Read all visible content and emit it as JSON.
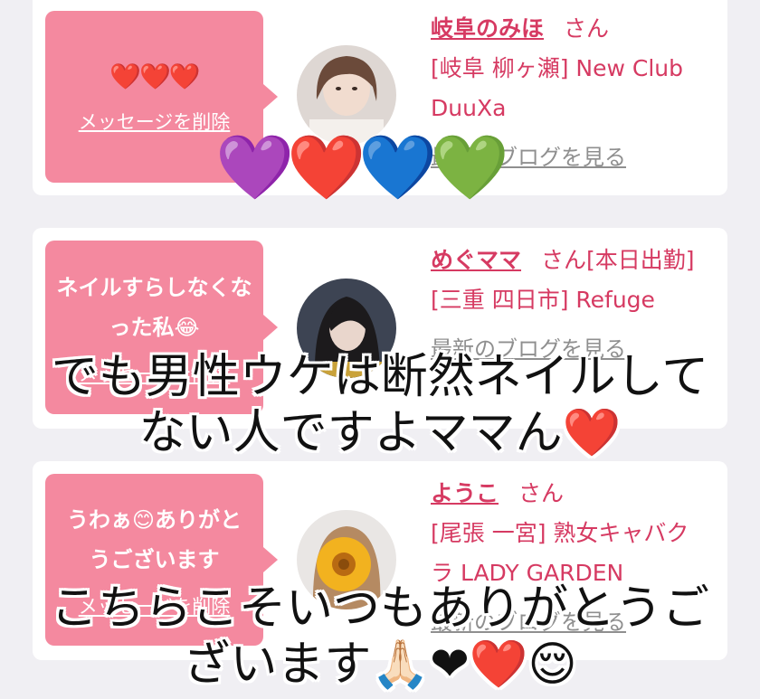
{
  "messages": [
    {
      "bubble_text": "❤️❤️❤️",
      "delete_label": "メッセージを削除",
      "name": "岐阜のみほ",
      "honorific": "さん",
      "name_suffix": "",
      "shop": "[岐阜 柳ヶ瀬] New Club DuuXa",
      "blog_label": "最新のブログを見る"
    },
    {
      "bubble_text": "ネイルすらしなくなった私😂",
      "delete_label": "メッセージを削除",
      "name": "めぐママ",
      "honorific": "さん",
      "name_suffix": "[本日出勤]",
      "shop": "[三重 四日市] Refuge",
      "blog_label": "最新のブログを見る"
    },
    {
      "bubble_text": "うわぁ😊ありがとうございます",
      "delete_label": "メッセージを削除",
      "name": "ようこ",
      "honorific": "さん",
      "name_suffix": "",
      "shop": "[尾張 一宮] 熟女キャバクラ LADY GARDEN",
      "blog_label": "最新のブログを見る"
    }
  ],
  "sticker": {
    "hearts": "💜❤️💙💚"
  },
  "captions": {
    "top_line1": "でも男性ウケは断然ネイルして",
    "top_line2": "ない人ですよママん❤️",
    "bottom_line1": "こちらこそいつもありがとうご",
    "bottom_line2": "ざいます🙏🏻❤❤️😌"
  },
  "colors": {
    "bubble": "#f4899f",
    "accent_text": "#d63a62",
    "blog_link": "#8f8f8f",
    "page_bg": "#f0eff3"
  }
}
